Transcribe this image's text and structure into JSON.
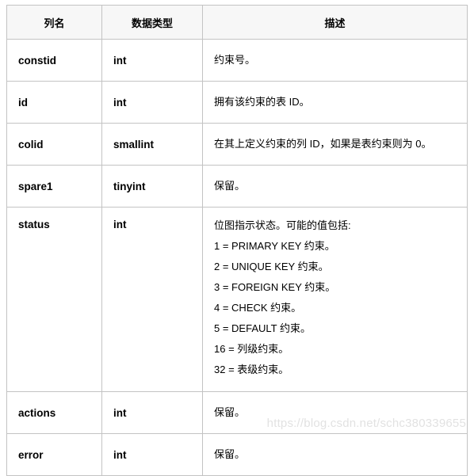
{
  "table": {
    "headers": [
      "列名",
      "数据类型",
      "描述"
    ],
    "rows": [
      {
        "name": "constid",
        "type": "int",
        "desc": "约束号。",
        "desc_lines": []
      },
      {
        "name": "id",
        "type": "int",
        "desc": "拥有该约束的表 ID。",
        "desc_lines": []
      },
      {
        "name": "colid",
        "type": "smallint",
        "desc": "在其上定义约束的列 ID，如果是表约束则为 0。",
        "desc_lines": []
      },
      {
        "name": "spare1",
        "type": "tinyint",
        "desc": "保留。",
        "desc_lines": []
      },
      {
        "name": "status",
        "type": "int",
        "desc": "位图指示状态。可能的值包括:",
        "desc_lines": [
          "1 = PRIMARY KEY 约束。",
          "2 = UNIQUE KEY 约束。",
          "3 = FOREIGN KEY 约束。",
          "4 = CHECK 约束。",
          "5 = DEFAULT 约束。",
          "16 = 列级约束。",
          "32 = 表级约束。"
        ]
      },
      {
        "name": "actions",
        "type": "int",
        "desc": "保留。",
        "desc_lines": []
      },
      {
        "name": "error",
        "type": "int",
        "desc": "保留。",
        "desc_lines": []
      }
    ]
  },
  "watermark": {
    "text": "https://blog.csdn.net/schc380339655"
  },
  "colors": {
    "border": "#c3c3c3",
    "header_bg": "#f7f7f7",
    "text": "#000000",
    "watermark": "#e2e2e2"
  }
}
